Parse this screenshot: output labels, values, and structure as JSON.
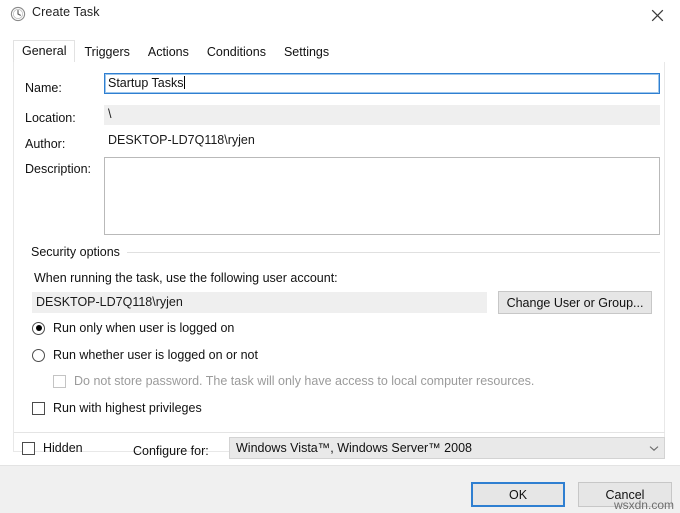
{
  "window": {
    "title": "Create Task",
    "icon": "clock-icon",
    "close_label": "close-icon"
  },
  "tabs": [
    {
      "label": "General",
      "active": true
    },
    {
      "label": "Triggers",
      "active": false
    },
    {
      "label": "Actions",
      "active": false
    },
    {
      "label": "Conditions",
      "active": false
    },
    {
      "label": "Settings",
      "active": false
    }
  ],
  "general": {
    "name_label": "Name:",
    "name_value": "Startup Tasks",
    "name_placeholder": "",
    "location_label": "Location:",
    "location_value": "\\",
    "author_label": "Author:",
    "author_value": "DESKTOP-LD7Q118\\ryjen",
    "description_label": "Description:",
    "description_value": "",
    "description_placeholder": ""
  },
  "security": {
    "group_label": "Security options",
    "account_prompt": "When running the task, use the following user account:",
    "account_value": "DESKTOP-LD7Q118\\ryjen",
    "change_user_button": "Change User or Group...",
    "run_logged_on": {
      "label": "Run only when user is logged on",
      "selected": true
    },
    "run_whether": {
      "label": "Run whether user is logged on or not",
      "selected": false
    },
    "no_store_password": {
      "label": "Do not store password.  The task will only have access to local computer resources.",
      "checked": false,
      "disabled": true
    },
    "highest_privileges": {
      "label": "Run with highest privileges",
      "checked": false
    }
  },
  "bottom": {
    "hidden_label": "Hidden",
    "hidden_checked": false,
    "configure_for_label": "Configure for:",
    "configure_for_value": "Windows Vista™, Windows Server™ 2008",
    "dropdown_icon": "chevron-down-icon"
  },
  "footer": {
    "ok_label": "OK",
    "cancel_label": "Cancel",
    "watermark": "wsxdn.com"
  },
  "colors": {
    "accent": "#2f7fd1",
    "dialog_bg": "#ffffff",
    "footer_bg": "#f0f0f0",
    "readonly_bg": "#efefef"
  }
}
